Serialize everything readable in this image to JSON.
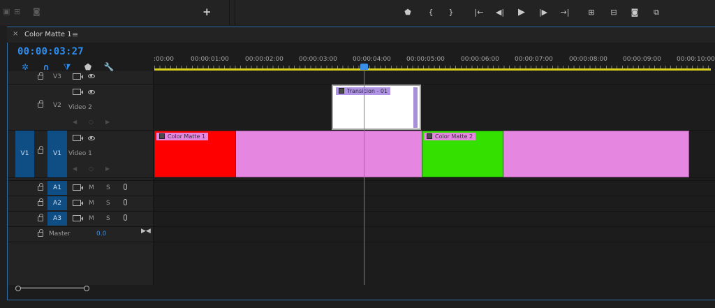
{
  "window": {
    "tab_title": "Color Matte 1",
    "close_glyph": "×",
    "menu_glyph": "≡",
    "plus_glyph": "+"
  },
  "timecode": "00:00:03:27",
  "ruler": {
    "labels": [
      ":00:00",
      "00:00:01:00",
      "00:00:02:00",
      "00:00:03:00",
      "00:00:04:00",
      "00:00:05:00",
      "00:00:06:00",
      "00:00:07:00",
      "00:00:08:00",
      "00:00:09:00",
      "00:00:10:00"
    ]
  },
  "tracks": {
    "v3": {
      "name": "V3"
    },
    "v2": {
      "name": "V2",
      "label": "Video 2"
    },
    "v1": {
      "source": "V1",
      "name": "V1",
      "label": "Video 1"
    },
    "a1": {
      "name": "A1",
      "m": "M",
      "s": "S"
    },
    "a2": {
      "name": "A2",
      "m": "M",
      "s": "S"
    },
    "a3": {
      "name": "A3",
      "m": "M",
      "s": "S"
    },
    "master": {
      "label": "Master",
      "value": "0.0"
    }
  },
  "clips": {
    "transition": {
      "label": "Transicion - 01"
    },
    "matte1": {
      "label": "Color Matte 1",
      "color": "#ff0000"
    },
    "matte2": {
      "label": "Color Matte 2",
      "color": "#33e000"
    },
    "pink": "#e586e0"
  },
  "colors": {
    "accent": "#2e8df0",
    "ruler_bar": "#d9d01d",
    "track_target": "#0f4e84"
  },
  "icons": {
    "transport": [
      "marker-icon",
      "mark-in-icon",
      "mark-out-icon",
      "go-to-in-icon",
      "step-back-icon",
      "play-icon",
      "step-forward-icon",
      "go-to-out-icon",
      "insert-icon",
      "overwrite-icon",
      "camera-icon",
      "comparison-icon"
    ]
  }
}
